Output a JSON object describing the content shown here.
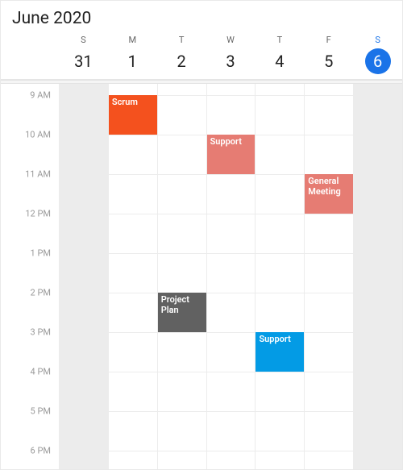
{
  "title": "June 2020",
  "hourHeight": 49,
  "viewStartHour": 9,
  "viewEndHour": 18,
  "days": [
    {
      "short": "S",
      "date": "31",
      "outside": true,
      "today": false
    },
    {
      "short": "M",
      "date": "1",
      "outside": false,
      "today": false
    },
    {
      "short": "T",
      "date": "2",
      "outside": false,
      "today": false
    },
    {
      "short": "W",
      "date": "3",
      "outside": false,
      "today": false
    },
    {
      "short": "T",
      "date": "4",
      "outside": false,
      "today": false
    },
    {
      "short": "F",
      "date": "5",
      "outside": false,
      "today": false
    },
    {
      "short": "S",
      "date": "6",
      "outside": true,
      "today": true
    }
  ],
  "hours": [
    {
      "value": 9,
      "label": "9 AM"
    },
    {
      "value": 10,
      "label": "10 AM"
    },
    {
      "value": 11,
      "label": "11 AM"
    },
    {
      "value": 12,
      "label": "12 PM"
    },
    {
      "value": 13,
      "label": "1 PM"
    },
    {
      "value": 14,
      "label": "2 PM"
    },
    {
      "value": 15,
      "label": "3 PM"
    },
    {
      "value": 16,
      "label": "4 PM"
    },
    {
      "value": 17,
      "label": "5 PM"
    },
    {
      "value": 18,
      "label": "6 PM"
    }
  ],
  "events": [
    {
      "title": "Scrum",
      "dayIndex": 1,
      "startHour": 9,
      "endHour": 10,
      "color": "#f4511e"
    },
    {
      "title": "Support",
      "dayIndex": 3,
      "startHour": 10,
      "endHour": 11,
      "color": "#e67c73"
    },
    {
      "title": "General Meeting",
      "dayIndex": 5,
      "startHour": 11,
      "endHour": 12,
      "color": "#e67c73"
    },
    {
      "title": "Project Plan",
      "dayIndex": 2,
      "startHour": 14,
      "endHour": 15,
      "color": "#616161"
    },
    {
      "title": "Support",
      "dayIndex": 4,
      "startHour": 15,
      "endHour": 16,
      "color": "#039be5"
    }
  ]
}
